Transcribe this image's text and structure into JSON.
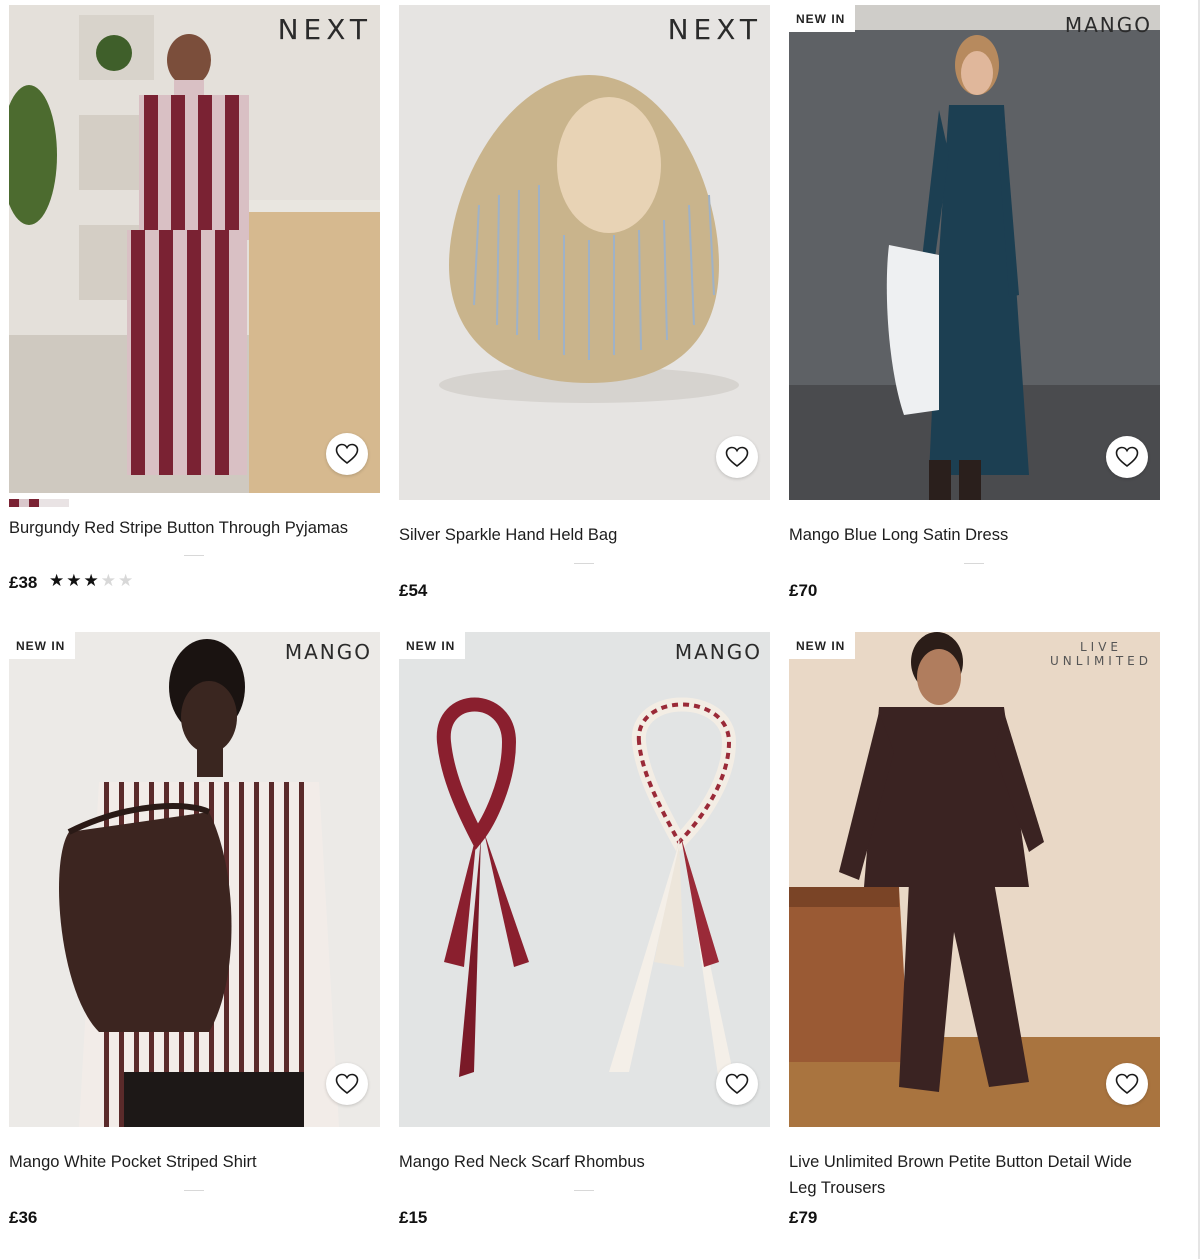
{
  "products": [
    {
      "brand": "NEXT",
      "badge": "",
      "title": "Burgundy Red Stripe Button Through Pyjamas",
      "price": "£38",
      "rating": 3,
      "rating_max": 5,
      "swatch_colors": [
        "#7a2233",
        "#d9c7cb",
        "#7a2233"
      ]
    },
    {
      "brand": "NEXT",
      "badge": "",
      "title": "Silver Sparkle Hand Held Bag",
      "price": "£54"
    },
    {
      "brand": "MANGO",
      "badge": "NEW IN",
      "title": "Mango Blue Long Satin Dress",
      "price": "£70"
    },
    {
      "brand": "MANGO",
      "badge": "NEW IN",
      "title": "Mango White Pocket Striped Shirt",
      "price": "£36"
    },
    {
      "brand": "MANGO",
      "badge": "NEW IN",
      "title": "Mango Red Neck Scarf Rhombus",
      "price": "£15"
    },
    {
      "brand_line1": "LIVE",
      "brand_line2": "UNLIMITED",
      "badge": "NEW IN",
      "title": "Live Unlimited Brown Petite Button Detail Wide Leg Trousers",
      "price": "£79"
    }
  ],
  "icons": {
    "favourite": "heart-outline-icon",
    "rating_star": "star-icon"
  },
  "colors": {
    "burgundy": "#7a2233",
    "text": "#1d1d1d",
    "badge_bg": "#ffffff"
  }
}
